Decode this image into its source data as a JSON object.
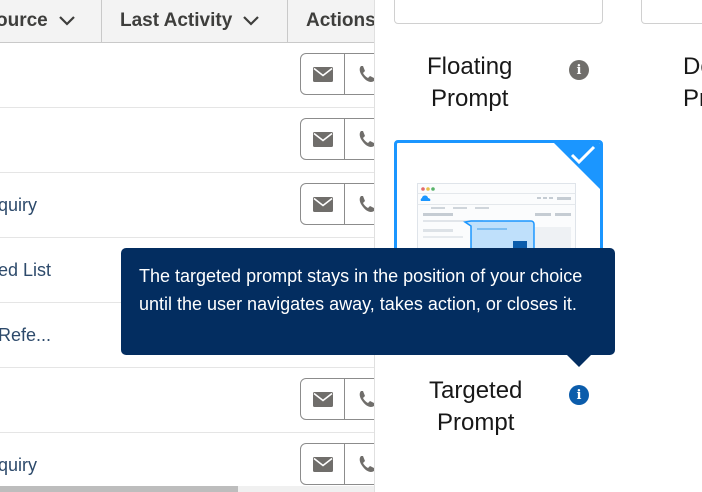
{
  "table": {
    "columns": [
      {
        "label": "ource"
      },
      {
        "label": "Last Activity"
      },
      {
        "label": "Actions"
      }
    ],
    "rows": [
      {
        "source": ""
      },
      {
        "source": ""
      },
      {
        "source": "quiry"
      },
      {
        "source": "ed List"
      },
      {
        "source": "Refe..."
      },
      {
        "source": ""
      },
      {
        "source": "quiry"
      }
    ],
    "action_icons": [
      "email-icon",
      "phone-icon"
    ]
  },
  "prompt_options": {
    "floating": {
      "line1": "Floating",
      "line2": "Prompt"
    },
    "docked": {
      "line1": "Do",
      "line2": "Pr"
    },
    "targeted": {
      "line1": "Targeted",
      "line2": "Prompt",
      "selected": true
    }
  },
  "tooltip": {
    "text": "The targeted prompt stays in the position of your choice until the user navigates away, takes action, or closes it."
  },
  "colors": {
    "selected_border": "#1b96ff",
    "tooltip_bg": "#032d60",
    "info_blue": "#0b5cab",
    "info_grey": "#706e6b",
    "link_text": "#2d4a6b"
  }
}
